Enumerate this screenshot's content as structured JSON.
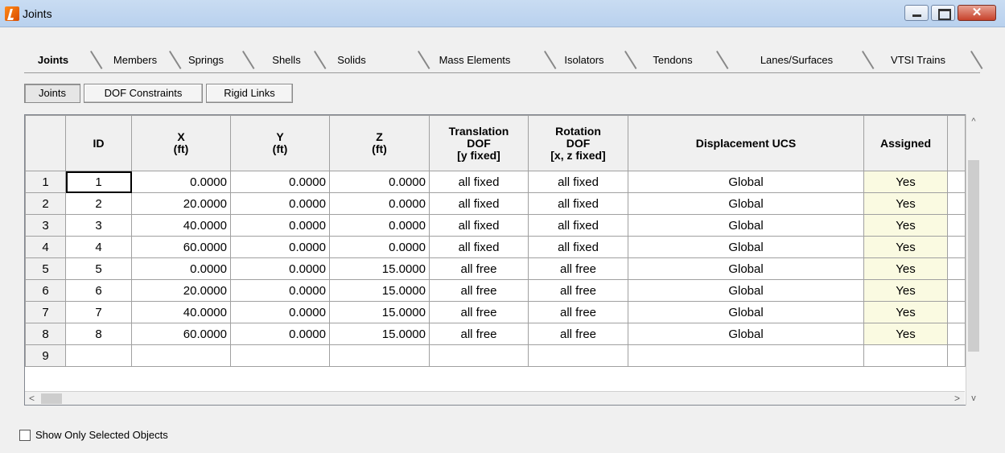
{
  "window": {
    "title": "Joints",
    "close_glyph": "✕"
  },
  "tabs": [
    {
      "label": "Joints",
      "active": true
    },
    {
      "label": "Members",
      "active": false
    },
    {
      "label": "Springs",
      "active": false
    },
    {
      "label": "Shells",
      "active": false
    },
    {
      "label": "Solids",
      "active": false
    },
    {
      "label": "Mass Elements",
      "active": false
    },
    {
      "label": "Isolators",
      "active": false
    },
    {
      "label": "Tendons",
      "active": false
    },
    {
      "label": "Lanes/Surfaces",
      "active": false
    },
    {
      "label": "VTSI Trains",
      "active": false
    }
  ],
  "subtabs": [
    {
      "label": "Joints",
      "active": true
    },
    {
      "label": "DOF Constraints",
      "active": false
    },
    {
      "label": "Rigid Links",
      "active": false
    }
  ],
  "table": {
    "headers": {
      "id": "ID",
      "x": "X",
      "x_unit": "(ft)",
      "y": "Y",
      "y_unit": "(ft)",
      "z": "Z",
      "z_unit": "(ft)",
      "trans_1": "Translation",
      "trans_2": "DOF",
      "trans_3": "[y fixed]",
      "rot_1": "Rotation",
      "rot_2": "DOF",
      "rot_3": "[x, z fixed]",
      "ucs": "Displacement UCS",
      "assigned": "Assigned"
    },
    "rows": [
      {
        "n": "1",
        "id": "1",
        "x": "0.0000",
        "y": "0.0000",
        "z": "0.0000",
        "trans": "all fixed",
        "rot": "all fixed",
        "ucs": "Global",
        "assigned": "Yes"
      },
      {
        "n": "2",
        "id": "2",
        "x": "20.0000",
        "y": "0.0000",
        "z": "0.0000",
        "trans": "all fixed",
        "rot": "all fixed",
        "ucs": "Global",
        "assigned": "Yes"
      },
      {
        "n": "3",
        "id": "3",
        "x": "40.0000",
        "y": "0.0000",
        "z": "0.0000",
        "trans": "all fixed",
        "rot": "all fixed",
        "ucs": "Global",
        "assigned": "Yes"
      },
      {
        "n": "4",
        "id": "4",
        "x": "60.0000",
        "y": "0.0000",
        "z": "0.0000",
        "trans": "all fixed",
        "rot": "all fixed",
        "ucs": "Global",
        "assigned": "Yes"
      },
      {
        "n": "5",
        "id": "5",
        "x": "0.0000",
        "y": "0.0000",
        "z": "15.0000",
        "trans": "all free",
        "rot": "all free",
        "ucs": "Global",
        "assigned": "Yes"
      },
      {
        "n": "6",
        "id": "6",
        "x": "20.0000",
        "y": "0.0000",
        "z": "15.0000",
        "trans": "all free",
        "rot": "all free",
        "ucs": "Global",
        "assigned": "Yes"
      },
      {
        "n": "7",
        "id": "7",
        "x": "40.0000",
        "y": "0.0000",
        "z": "15.0000",
        "trans": "all free",
        "rot": "all free",
        "ucs": "Global",
        "assigned": "Yes"
      },
      {
        "n": "8",
        "id": "8",
        "x": "60.0000",
        "y": "0.0000",
        "z": "15.0000",
        "trans": "all free",
        "rot": "all free",
        "ucs": "Global",
        "assigned": "Yes"
      },
      {
        "n": "9",
        "id": "",
        "x": "",
        "y": "",
        "z": "",
        "trans": "",
        "rot": "",
        "ucs": "",
        "assigned": ""
      }
    ]
  },
  "scrollbar": {
    "up": "^",
    "down": "v",
    "left": "<",
    "right": ">"
  },
  "footer": {
    "show_selected_label": "Show Only Selected Objects",
    "show_selected_checked": false
  },
  "colors": {
    "assigned_bg": "#fafae1",
    "titlebar": "#c9dcf2",
    "close_button": "#c7422b"
  }
}
